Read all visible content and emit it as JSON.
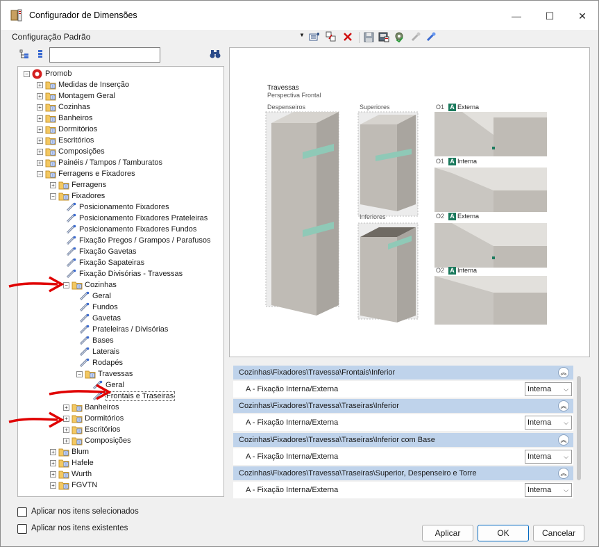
{
  "window": {
    "title": "Configurador de Dimensões",
    "minimize_glyph": "—",
    "maximize_glyph": "☐",
    "close_glyph": "✕"
  },
  "toolbar": {
    "configuration": "Configuração Padrão",
    "icons": [
      "add-config-icon",
      "copy-config-icon",
      "delete-icon",
      "save-icon",
      "export-icon",
      "settings-icon",
      "link-disabled-icon",
      "link-icon"
    ]
  },
  "tree": {
    "search_value": "",
    "items": [
      {
        "label": "Promob",
        "level": 0,
        "expanded": true,
        "type": "root"
      },
      {
        "label": "Medidas de Inserção",
        "level": 1,
        "expanded": false,
        "type": "folder"
      },
      {
        "label": "Montagem Geral",
        "level": 1,
        "expanded": false,
        "type": "folder"
      },
      {
        "label": "Cozinhas",
        "level": 1,
        "expanded": false,
        "type": "folder"
      },
      {
        "label": "Banheiros",
        "level": 1,
        "expanded": false,
        "type": "folder"
      },
      {
        "label": "Dormitórios",
        "level": 1,
        "expanded": false,
        "type": "folder"
      },
      {
        "label": "Escritórios",
        "level": 1,
        "expanded": false,
        "type": "folder"
      },
      {
        "label": "Composições",
        "level": 1,
        "expanded": false,
        "type": "folder"
      },
      {
        "label": "Painéis / Tampos / Tamburatos",
        "level": 1,
        "expanded": false,
        "type": "folder"
      },
      {
        "label": "Ferragens e Fixadores",
        "level": 1,
        "expanded": true,
        "type": "folder"
      },
      {
        "label": "Ferragens",
        "level": 2,
        "expanded": false,
        "type": "folder"
      },
      {
        "label": "Fixadores",
        "level": 2,
        "expanded": true,
        "type": "folder"
      },
      {
        "label": "Posicionamento Fixadores",
        "level": 3,
        "type": "item"
      },
      {
        "label": "Posicionamento Fixadores Prateleiras",
        "level": 3,
        "type": "item"
      },
      {
        "label": "Posicionamento Fixadores Fundos",
        "level": 3,
        "type": "item"
      },
      {
        "label": "Fixação Pregos / Grampos / Parafusos",
        "level": 3,
        "type": "item"
      },
      {
        "label": "Fixação Gavetas",
        "level": 3,
        "type": "item"
      },
      {
        "label": "Fixação Sapateiras",
        "level": 3,
        "type": "item"
      },
      {
        "label": "Fixação Divisórias - Travessas",
        "level": 3,
        "type": "item"
      },
      {
        "label": "Cozinhas",
        "level": 3,
        "expanded": true,
        "type": "folder"
      },
      {
        "label": "Geral",
        "level": 4,
        "type": "item"
      },
      {
        "label": "Fundos",
        "level": 4,
        "type": "item"
      },
      {
        "label": "Gavetas",
        "level": 4,
        "type": "item"
      },
      {
        "label": "Prateleiras / Divisórias",
        "level": 4,
        "type": "item"
      },
      {
        "label": "Bases",
        "level": 4,
        "type": "item"
      },
      {
        "label": "Laterais",
        "level": 4,
        "type": "item"
      },
      {
        "label": "Rodapés",
        "level": 4,
        "type": "item"
      },
      {
        "label": "Travessas",
        "level": 4,
        "expanded": true,
        "type": "folder"
      },
      {
        "label": "Geral",
        "level": 5,
        "type": "item"
      },
      {
        "label": "Frontais e Traseiras",
        "level": 5,
        "type": "item",
        "selected": true
      },
      {
        "label": "Banheiros",
        "level": 3,
        "expanded": false,
        "type": "folder"
      },
      {
        "label": "Dormitórios",
        "level": 3,
        "expanded": false,
        "type": "folder"
      },
      {
        "label": "Escritórios",
        "level": 3,
        "expanded": false,
        "type": "folder"
      },
      {
        "label": "Composições",
        "level": 3,
        "expanded": false,
        "type": "folder"
      },
      {
        "label": "Blum",
        "level": 2,
        "expanded": false,
        "type": "folder"
      },
      {
        "label": "Hafele",
        "level": 2,
        "expanded": false,
        "type": "folder"
      },
      {
        "label": "Wurth",
        "level": 2,
        "expanded": false,
        "type": "folder"
      },
      {
        "label": "FGVTN",
        "level": 2,
        "expanded": false,
        "type": "folder"
      }
    ]
  },
  "preview": {
    "title": "Travessas",
    "subtitle": "Perspectiva Frontal",
    "labels": {
      "despenseiros": "Despenseiros",
      "superiores": "Superiores",
      "inferiores": "Inferiores"
    },
    "options": [
      {
        "code": "O1",
        "badge": "A",
        "label": "Externa"
      },
      {
        "code": "O1",
        "badge": "A",
        "label": "Interna"
      },
      {
        "code": "O2",
        "badge": "A",
        "label": "Externa"
      },
      {
        "code": "O2",
        "badge": "A",
        "label": "Interna"
      }
    ]
  },
  "properties": {
    "groups": [
      {
        "header": "Cozinhas\\Fixadores\\Travessa\\Frontais\\Inferior",
        "property": "A - Fixação Interna/Externa",
        "value": "Interna"
      },
      {
        "header": "Cozinhas\\Fixadores\\Travessa\\Traseiras\\Inferior",
        "property": "A - Fixação Interna/Externa",
        "value": "Interna"
      },
      {
        "header": "Cozinhas\\Fixadores\\Travessa\\Traseiras\\Inferior com Base",
        "property": "A - Fixação Interna/Externa",
        "value": "Interna"
      },
      {
        "header": "Cozinhas\\Fixadores\\Travessa\\Traseiras\\Superior, Despenseiro e Torre",
        "property": "A - Fixação Interna/Externa",
        "value": "Interna"
      }
    ]
  },
  "options": {
    "apply_selected": "Aplicar nos itens selecionados",
    "apply_existing": "Aplicar nos itens existentes"
  },
  "buttons": {
    "apply": "Aplicar",
    "ok": "OK",
    "cancel": "Cancelar"
  },
  "colors": {
    "accent_green": "#1b7a5d",
    "group_header": "#bfd3eb",
    "arrow_red": "#e00000",
    "folder": "#f3c862"
  }
}
